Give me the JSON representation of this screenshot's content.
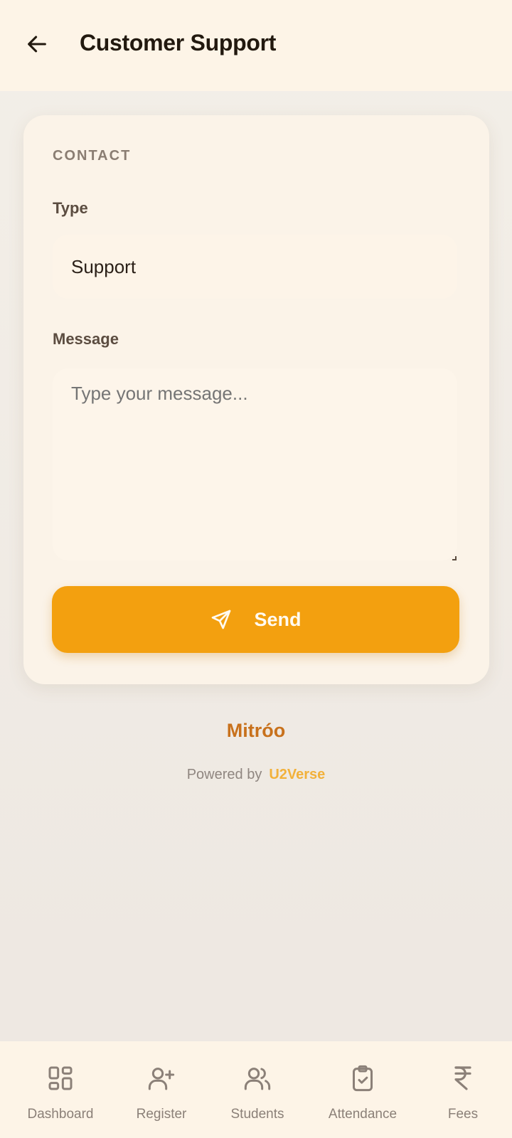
{
  "header": {
    "back_icon": "arrow-left-icon",
    "title": "Customer Support"
  },
  "form": {
    "section_label": "CONTACT",
    "type_label": "Type",
    "type_value": "Support",
    "message_label": "Message",
    "message_placeholder": "Type your message...",
    "message_value": "",
    "send_icon": "send-icon",
    "send_label": "Send"
  },
  "footer": {
    "brand": "Mitróo",
    "powered_by": "Powered by",
    "powered_brand": "U2Verse"
  },
  "bottom_nav": {
    "items": [
      {
        "label": "Dashboard",
        "icon": "dashboard-icon"
      },
      {
        "label": "Register",
        "icon": "user-plus-icon"
      },
      {
        "label": "Students",
        "icon": "users-icon"
      },
      {
        "label": "Attendance",
        "icon": "clipboard-check-icon"
      },
      {
        "label": "Fees",
        "icon": "rupee-icon"
      }
    ]
  },
  "colors": {
    "accent": "#f3a00f",
    "brand": "#c8711c",
    "powered_brand": "#f2b13a",
    "surface": "#fbf3e8"
  }
}
